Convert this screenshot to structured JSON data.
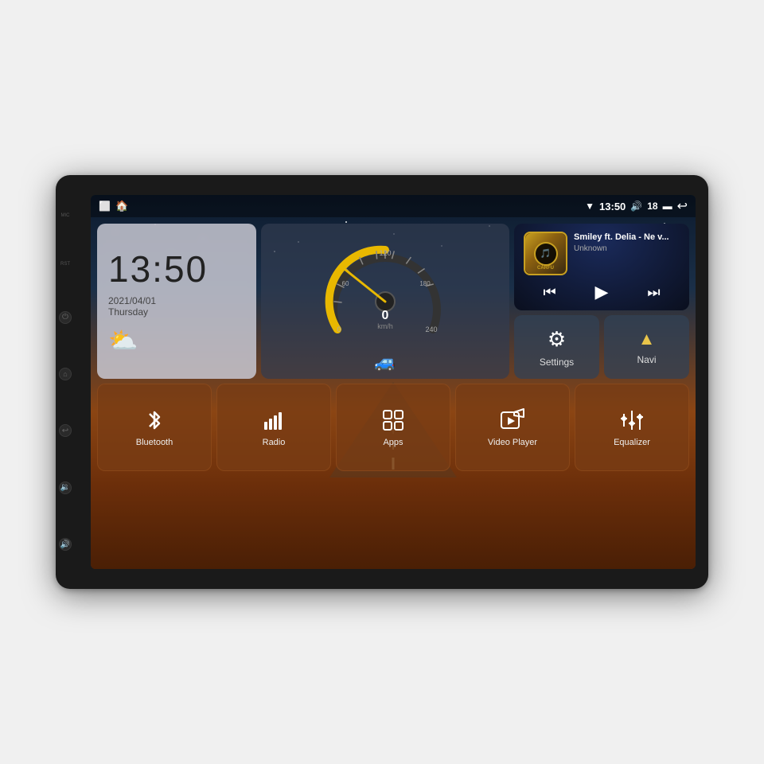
{
  "device": {
    "label": "Car Head Unit"
  },
  "statusBar": {
    "homeIcon": "⌂",
    "appIcon": "🏠",
    "time": "13:50",
    "volumIcon": "🔊",
    "volumeLevel": "18",
    "batteryIcon": "🔋",
    "backIcon": "↩",
    "wifiIcon": "▼"
  },
  "clockWidget": {
    "time": "13:50",
    "date": "2021/04/01",
    "day": "Thursday",
    "weatherIcon": "⛅"
  },
  "speedometer": {
    "speed": "0",
    "unit": "km/h",
    "maxSpeed": "240"
  },
  "musicWidget": {
    "title": "Smiley ft. Delia - Ne v...",
    "artist": "Unknown",
    "prevIcon": "⏮",
    "playIcon": "▶",
    "nextIcon": "⏭"
  },
  "topButtons": [
    {
      "id": "settings",
      "label": "Settings",
      "icon": "⚙"
    },
    {
      "id": "navi",
      "label": "Navi",
      "icon": "▲"
    }
  ],
  "appButtons": [
    {
      "id": "bluetooth",
      "label": "Bluetooth",
      "icon": "bluetooth"
    },
    {
      "id": "radio",
      "label": "Radio",
      "icon": "radio"
    },
    {
      "id": "apps",
      "label": "Apps",
      "icon": "apps"
    },
    {
      "id": "video-player",
      "label": "Video Player",
      "icon": "video"
    },
    {
      "id": "equalizer",
      "label": "Equalizer",
      "icon": "equalizer"
    }
  ],
  "sideButtons": {
    "micLabel": "MIC",
    "rstLabel": "RST"
  }
}
